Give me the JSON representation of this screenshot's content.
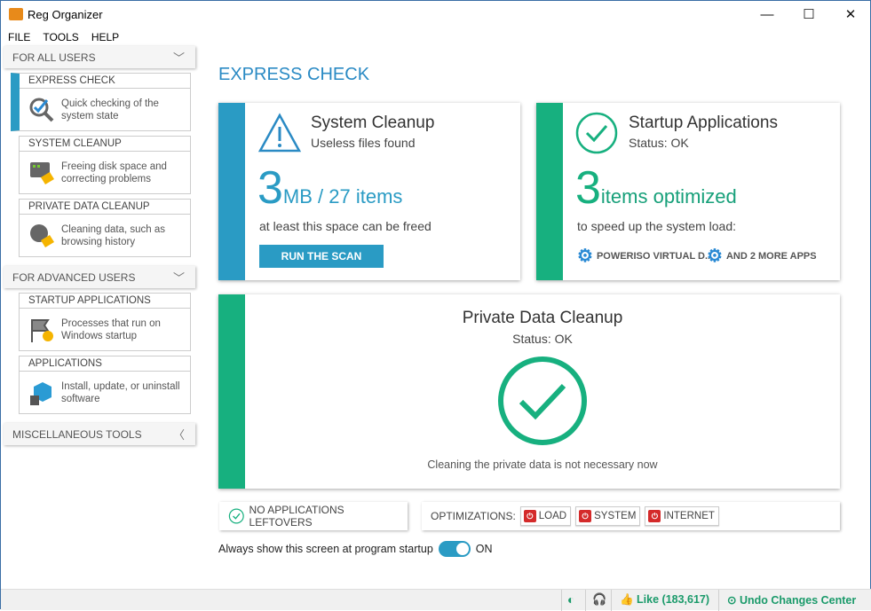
{
  "window": {
    "title": "Reg Organizer",
    "minimize": "—",
    "maximize": "☐",
    "close": "✕"
  },
  "menu": [
    "FILE",
    "TOOLS",
    "HELP"
  ],
  "sidebar": {
    "groups": [
      {
        "label": "FOR ALL USERS"
      },
      {
        "label": "FOR ADVANCED USERS"
      },
      {
        "label": "MISCELLANEOUS TOOLS"
      }
    ],
    "items": [
      {
        "title": "EXPRESS CHECK",
        "desc": "Quick checking of the system state",
        "icon": "magnifier-check-icon",
        "active": true
      },
      {
        "title": "SYSTEM CLEANUP",
        "desc": "Freeing disk space and correcting problems",
        "icon": "monitor-broom-icon"
      },
      {
        "title": "PRIVATE DATA CLEANUP",
        "desc": "Cleaning data, such as browsing history",
        "icon": "user-broom-icon"
      },
      {
        "title": "STARTUP APPLICATIONS",
        "desc": "Processes that run on Windows startup",
        "icon": "flag-gear-icon"
      },
      {
        "title": "APPLICATIONS",
        "desc": "Install, update, or uninstall software",
        "icon": "box-trash-icon"
      }
    ]
  },
  "main": {
    "heading": "EXPRESS CHECK",
    "system_cleanup": {
      "title": "System Cleanup",
      "subtitle": "Useless files found",
      "big": "3",
      "unit": "MB / 27 items",
      "note": "at least this space can be freed",
      "button": "RUN THE SCAN",
      "color": "#2a9bc4"
    },
    "startup": {
      "title": "Startup Applications",
      "subtitle": "Status: OK",
      "big": "3",
      "unit": "items optimized",
      "note": "to speed up the system load:",
      "apps": [
        "POWERISO VIRTUAL D...",
        "AND 2 MORE APPS"
      ],
      "color": "#17b07f"
    },
    "private": {
      "title": "Private Data Cleanup",
      "subtitle": "Status: OK",
      "note": "Cleaning the private data is not necessary now"
    },
    "leftovers": "NO APPLICATIONS LEFTOVERS",
    "optimizations": {
      "label": "OPTIMIZATIONS:",
      "items": [
        "LOAD",
        "SYSTEM",
        "INTERNET"
      ]
    },
    "startup_toggle": {
      "label": "Always show this screen at program startup",
      "state": "ON"
    }
  },
  "statusbar": {
    "like": "Like (183,617)",
    "undo": "Undo Changes Center"
  }
}
